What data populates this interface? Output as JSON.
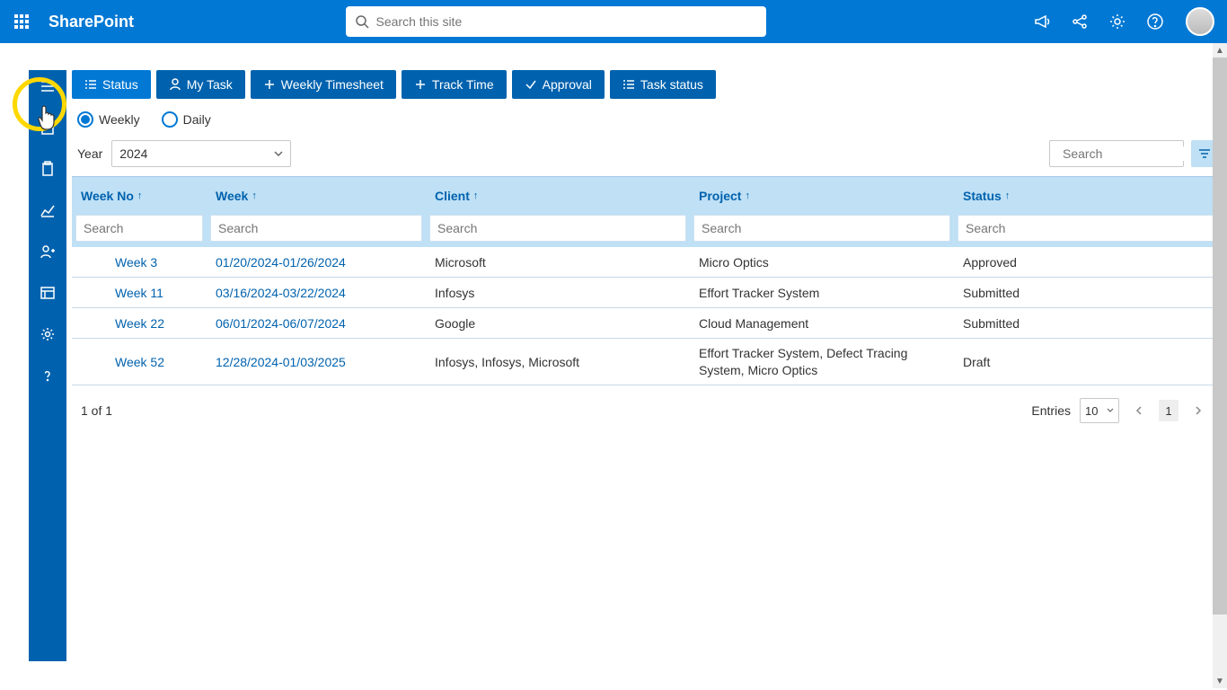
{
  "header": {
    "app_title": "SharePoint",
    "search_placeholder": "Search this site"
  },
  "toolbar": {
    "status": "Status",
    "my_task": "My Task",
    "weekly_timesheet": "Weekly Timesheet",
    "track_time": "Track Time",
    "approval": "Approval",
    "task_status": "Task status"
  },
  "view": {
    "weekly": "Weekly",
    "daily": "Daily"
  },
  "year": {
    "label": "Year",
    "value": "2024"
  },
  "grid_search_placeholder": "Search",
  "columns": {
    "week_no": "Week No",
    "week": "Week",
    "client": "Client",
    "project": "Project",
    "status": "Status",
    "search_placeholder": "Search"
  },
  "rows": [
    {
      "week_no": "Week 3",
      "week": "01/20/2024-01/26/2024",
      "client": "Microsoft",
      "project": "Micro Optics",
      "status": "Approved"
    },
    {
      "week_no": "Week 11",
      "week": "03/16/2024-03/22/2024",
      "client": "Infosys",
      "project": "Effort Tracker System",
      "status": "Submitted"
    },
    {
      "week_no": "Week 22",
      "week": "06/01/2024-06/07/2024",
      "client": "Google",
      "project": "Cloud Management",
      "status": "Submitted"
    },
    {
      "week_no": "Week 52",
      "week": "12/28/2024-01/03/2025",
      "client": "Infosys, Infosys, Microsoft",
      "project": "Effort Tracker System, Defect Tracing System, Micro Optics",
      "status": "Draft"
    }
  ],
  "pager": {
    "summary": "1 of 1",
    "entries_label": "Entries",
    "page_size": "10",
    "current_page": "1"
  }
}
